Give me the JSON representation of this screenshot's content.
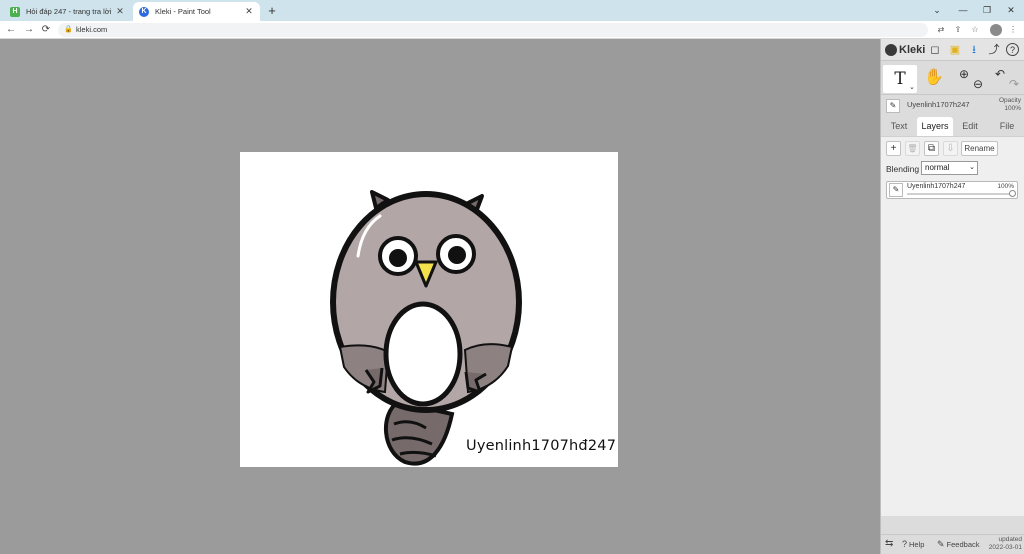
{
  "browser": {
    "tabs": [
      {
        "title": "Hỏi đáp 247 - trang tra lời",
        "favicon": "H",
        "active": false
      },
      {
        "title": "Kleki - Paint Tool",
        "favicon": "K",
        "active": true
      }
    ],
    "new_tab": "+",
    "window_controls": {
      "minimize": "⌄",
      "restore": "❐",
      "maximize": "—",
      "close": "✕"
    },
    "address": "kleki.com",
    "nav": {
      "back": "←",
      "forward": "→",
      "reload": "⟳"
    },
    "toolbar_icons": {
      "translate": "⇄",
      "share": "⇪",
      "bookmark": "☆",
      "menu": "⋮"
    }
  },
  "canvas": {
    "signature": "Uyenlinh1707hđ247",
    "colors": {
      "owl_body": "#b3a6a6",
      "owl_dark": "#766a6a",
      "outline": "#111111",
      "beak": "#f2e04c",
      "background": "#9b9b9b"
    }
  },
  "sidebar": {
    "logo": "Kleki",
    "top_icons": {
      "new": "◻",
      "save": "▣",
      "download": "⭳",
      "share": "⤴",
      "help": "?"
    },
    "tools": {
      "text": "T",
      "text_caret": "⌄",
      "hand": "✋",
      "zoom_in": "⊕",
      "zoom_out": "⊖",
      "undo": "↶",
      "redo": "↷"
    },
    "current_layer": {
      "name": "Uyenlinh1707h247",
      "opacity_label": "Opacity",
      "opacity_value": "100%"
    },
    "tabs": [
      {
        "label": "Text",
        "active": false
      },
      {
        "label": "Layers",
        "active": true
      },
      {
        "label": "Edit",
        "active": false
      },
      {
        "label": "File",
        "active": false
      }
    ],
    "layers_panel": {
      "add": "+",
      "delete": "🗑",
      "duplicate": "⧉",
      "merge": "⇩",
      "rename": "Rename",
      "blending_label": "Blending",
      "blending_value": "normal",
      "layers": [
        {
          "name": "Uyenlinh1707h247",
          "opacity": "100%",
          "opacity_fraction": 1.0
        }
      ]
    },
    "bottom": {
      "swap_icon": "⇆",
      "help_icon": "?",
      "help": "Help",
      "feedback_icon": "✎",
      "feedback": "Feedback",
      "updated_label": "updated",
      "updated_date": "2022-03-01"
    }
  }
}
